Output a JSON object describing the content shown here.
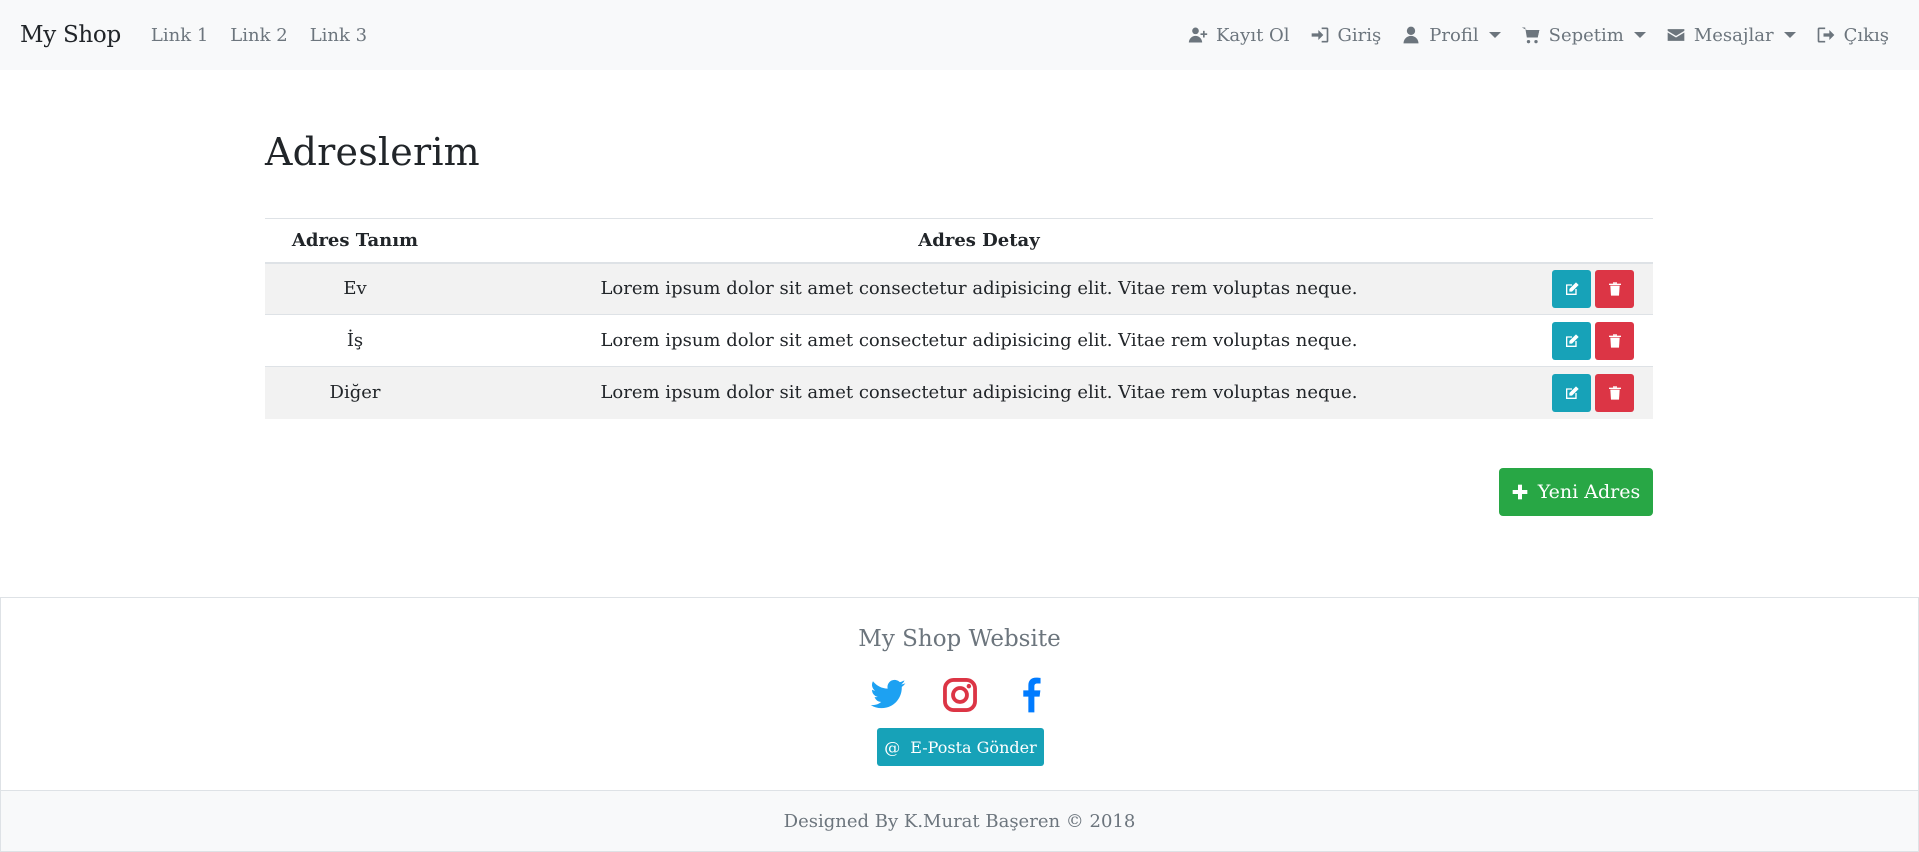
{
  "navbar": {
    "brand": "My Shop",
    "links": [
      "Link 1",
      "Link 2",
      "Link 3"
    ],
    "right": {
      "register": "Kayıt Ol",
      "login": "Giriş",
      "profile": "Profil",
      "cart": "Sepetim",
      "messages": "Mesajlar",
      "logout": "Çıkış"
    }
  },
  "main": {
    "title": "Adreslerim",
    "table": {
      "headers": {
        "name": "Adres Tanım",
        "detail": "Adres Detay"
      },
      "rows": [
        {
          "name": "Ev",
          "detail": "Lorem ipsum dolor sit amet consectetur adipisicing elit. Vitae rem voluptas neque."
        },
        {
          "name": "İş",
          "detail": "Lorem ipsum dolor sit amet consectetur adipisicing elit. Vitae rem voluptas neque."
        },
        {
          "name": "Diğer",
          "detail": "Lorem ipsum dolor sit amet consectetur adipisicing elit. Vitae rem voluptas neque."
        }
      ]
    },
    "new_button": "Yeni Adres"
  },
  "footer": {
    "title": "My Shop Website",
    "social_icons": [
      "twitter-icon",
      "instagram-icon",
      "facebook-icon"
    ],
    "mail_symbol": "@",
    "mail_button": "E-Posta Gönder",
    "copyright": "Designed By K.Murat Başeren © 2018"
  },
  "colors": {
    "info": "#17a2b8",
    "danger": "#dc3545",
    "success": "#28a745",
    "twitter": "#1da1f2",
    "instagram": "#dc3545",
    "facebook": "#007bff"
  }
}
